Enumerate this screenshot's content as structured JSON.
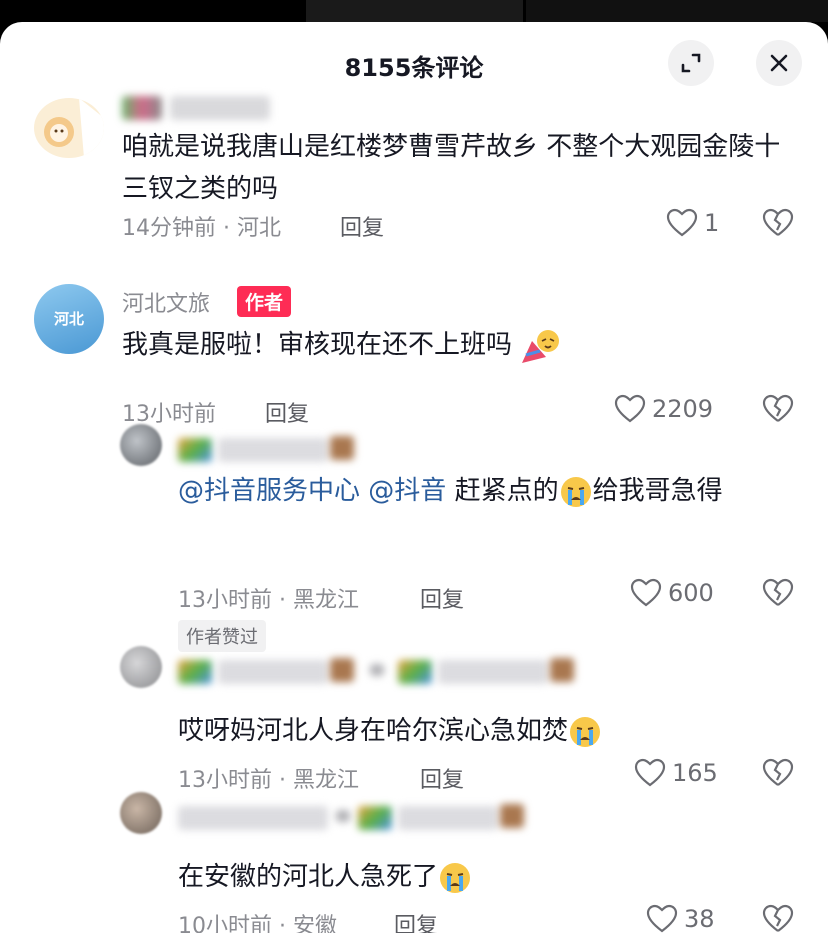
{
  "header": {
    "title": "8155条评论"
  },
  "comments": [
    {
      "text": "咱就是说我唐山是红楼梦曹雪芹故乡  不整个大观园金陵十三钗之类的吗",
      "time": "14分钟前 · 河北",
      "reply_label": "回复",
      "likes": "1"
    },
    {
      "username": "河北文旅",
      "badge": "作者",
      "avatar_text": "河北",
      "text": "我真是服啦！审核现在还不上班吗",
      "time": "13小时前",
      "reply_label": "回复",
      "likes": "2209"
    },
    {
      "mention1": "@抖音服务中心",
      "mention2": "@抖音",
      "text_rest": "赶紧点的",
      "text_tail": "给我哥急得",
      "time": "13小时前 · 黑龙江",
      "reply_label": "回复",
      "likes": "600",
      "liked_tag": "作者赞过"
    },
    {
      "text": "哎呀妈河北人身在哈尔滨心急如焚",
      "time": "13小时前 · 黑龙江",
      "reply_label": "回复",
      "likes": "165"
    },
    {
      "text": "在安徽的河北人急死了",
      "time": "10小时前 · 安徽",
      "reply_label": "回复",
      "likes": "38"
    }
  ],
  "icons": {
    "expand": "expand-icon",
    "close": "close-icon",
    "like": "heart-icon",
    "dislike": "broken-heart-icon",
    "crying": "crying-face-emoji",
    "celebrate": "party-face-emoji"
  },
  "colors": {
    "accent": "#fe2c55",
    "mention": "#2a5c9c"
  }
}
